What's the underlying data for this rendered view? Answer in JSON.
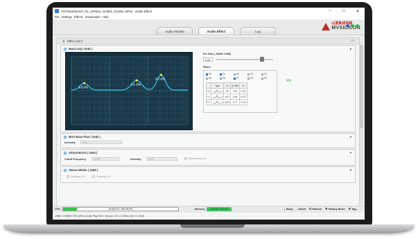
{
  "window": {
    "title": "ACPWorkbench_for_AP82xx, DU58x, DU26x, BPxx - Audio Effect",
    "controls": [
      "–",
      "□",
      "✕"
    ]
  },
  "menu": [
    "File",
    "Settings",
    "Effects",
    "Downloader",
    "Help"
  ],
  "tabs": [
    {
      "label": "Audio Module",
      "active": false
    },
    {
      "label": "Audio Effect",
      "active": true
    },
    {
      "label": "Log",
      "active": false
    }
  ],
  "logo": {
    "cn": "山景集成电路",
    "en": "MVSILICON"
  },
  "effect_list": {
    "label": "Effect List 0",
    "expand": "▼",
    "more": ">>"
  },
  "music_eq": {
    "title": "Music EQ ( 0x81 )",
    "pregain_label": "Pre Gain ( -96dB~12dB)",
    "pregain_value": "0.00",
    "pregain_fraction": 0.8,
    "filters_label": "Filters",
    "filter_checks": [
      {
        "label": "F0",
        "on": true
      },
      {
        "label": "F1",
        "on": true
      },
      {
        "label": "F2",
        "on": false
      },
      {
        "label": "F3",
        "on": false
      },
      {
        "label": "F4",
        "on": false
      },
      {
        "label": "F5",
        "on": false
      },
      {
        "label": "F6",
        "on": false
      },
      {
        "label": "F7",
        "on": true
      },
      {
        "label": "F8",
        "on": false
      },
      {
        "label": "F9",
        "on": false
      }
    ],
    "table_headers": [
      "",
      "Type",
      "Fc",
      "Q/ BW",
      "G"
    ],
    "rows": [
      {
        "id": "F0",
        "fc": "95",
        "q": "3.00",
        "g": "0.707"
      },
      {
        "id": "F1",
        "fc": "1017",
        "q": "2.98",
        "g": "0.707"
      },
      {
        "id": "F7",
        "fc": "8476",
        "q": "5.77",
        "g": "0.700"
      }
    ],
    "points": [
      {
        "label": "F0-PK"
      },
      {
        "label": "F1-PK"
      },
      {
        "label": "F7-PK"
      }
    ],
    "expand_arrows": ">>"
  },
  "mvs_bass_plus": {
    "title": "MVS Bass Plus ( 0x82 )",
    "intensity_label": "Intensity",
    "intensity_value": "50%"
  },
  "virtual_bass": {
    "title": "Virtual BASS ( 0x83 )",
    "cutoff_label": "Cutoff Frequency",
    "cutoff_value": "100Hz",
    "intensity_label": "Intensity",
    "intensity_value": "50%",
    "enhanced_label": "BassEnhanced"
  },
  "stereo_widen": {
    "title": "Stereo Widen ( 0x84 )",
    "option1": "Shaping Off",
    "option2": "Shaping On"
  },
  "status": {
    "cpu_label": "CPU",
    "cpu_text": "35 MCPS / 288 MCPS",
    "cpu_fraction": 0.12,
    "memory_label": "Memory",
    "memory_text": "206 KB / 320 KB",
    "actions": [
      {
        "icon": "◖",
        "label": "Sleep"
      },
      {
        "icon": "◔",
        "label": "Reset"
      },
      {
        "icon": "↻",
        "label": "Refresh"
      },
      {
        "icon": "✎",
        "label": "Factory Reset"
      },
      {
        "icon": "✐",
        "label": "Tag..."
      }
    ]
  },
  "footer": {
    "text": "USB0 CONNECTED  (BPxx Audio Play SDK, Version: V0.1.1)  Effect Lib: V1.35.8)"
  }
}
